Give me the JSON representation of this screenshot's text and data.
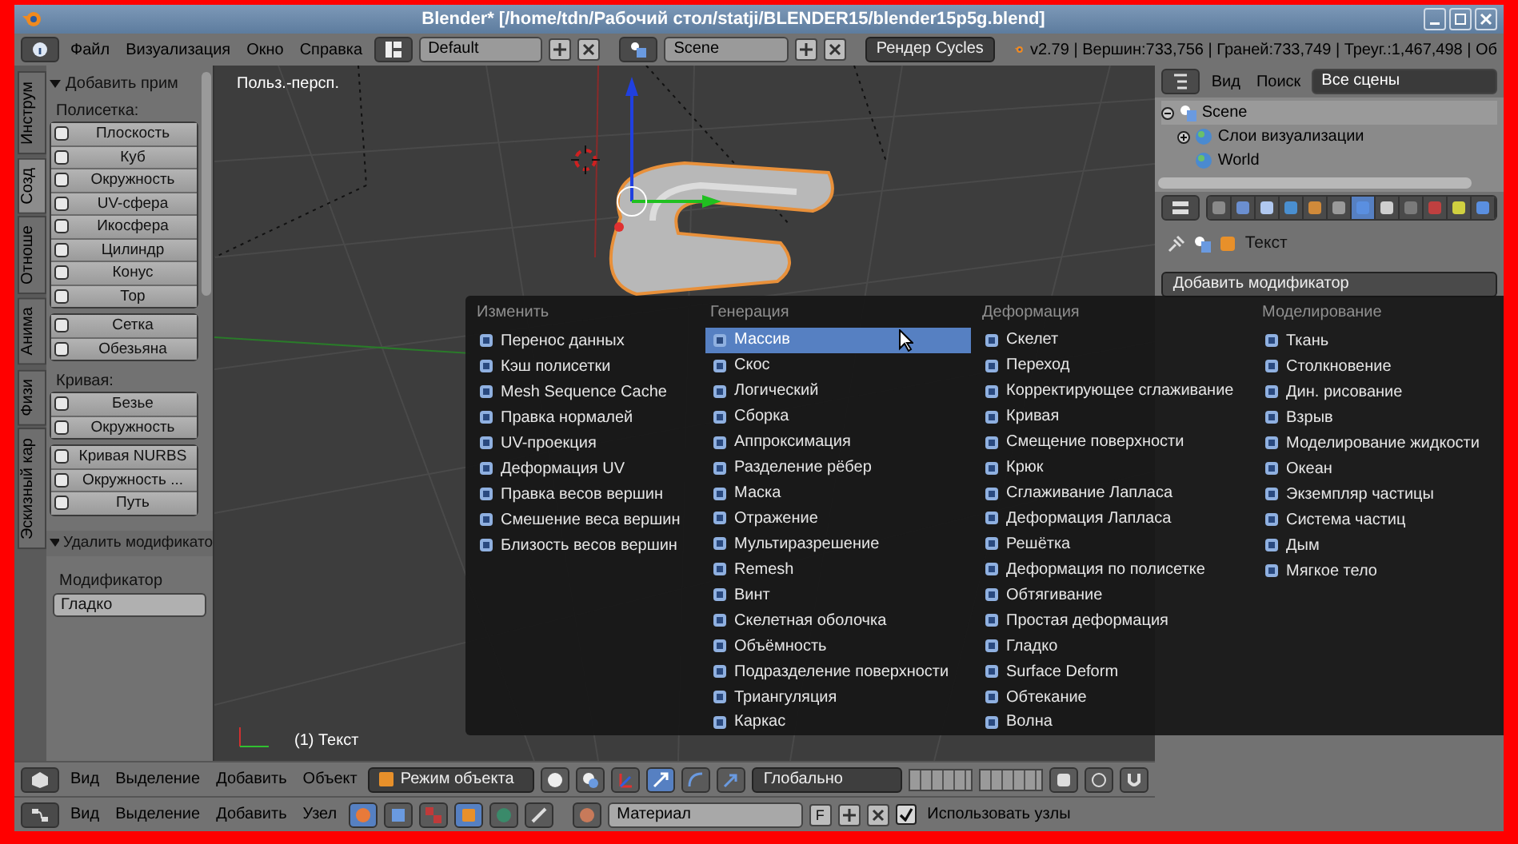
{
  "window": {
    "title": "Blender* [/home/tdn/Рабочий стол/statji/BLENDER15/blender15p5g.blend]"
  },
  "info_header": {
    "menus": [
      "Файл",
      "Визуализация",
      "Окно",
      "Справка"
    ],
    "layout": "Default",
    "scene": "Scene",
    "render_engine": "Рендер Cycles",
    "stats": "v2.79 | Вершин:733,756 | Граней:733,749 | Треуг.:1,467,498 | Об"
  },
  "tool_shelf": {
    "tabs": [
      {
        "label": "Инструм",
        "selected": false
      },
      {
        "label": "Созд",
        "selected": true
      },
      {
        "label": "Отноше",
        "selected": false
      },
      {
        "label": "Анима",
        "selected": false
      },
      {
        "label": "Физи",
        "selected": false
      },
      {
        "label": "Эскизный кар",
        "selected": false
      }
    ],
    "panel_title": "Добавить прим",
    "groups": [
      {
        "label": "Полисетка:",
        "blocks": [
          [
            "Плоскость",
            "Куб",
            "Окружность",
            "UV-сфера",
            "Икосфера",
            "Цилиндр",
            "Конус",
            "Тор"
          ],
          [
            "Сетка",
            "Обезьяна"
          ]
        ]
      },
      {
        "label": "Кривая:",
        "blocks": [
          [
            "Безье",
            "Окружность"
          ],
          [
            "Кривая NURBS",
            "Окружность ...",
            "Путь"
          ]
        ]
      }
    ],
    "remove_panel": {
      "title": "Удалить модификато",
      "label": "Модификатор",
      "value": "Гладко"
    }
  },
  "viewport": {
    "view_label": "Польз.-персп.",
    "object_label": "(1) Текст"
  },
  "add_modifier_menu": {
    "columns": [
      {
        "title": "Изменить",
        "items": [
          {
            "label": "Перенос данных",
            "selected": false
          },
          {
            "label": "Кэш полисетки",
            "selected": false
          },
          {
            "label": "Mesh Sequence Cache",
            "selected": false
          },
          {
            "label": "Правка нормалей",
            "selected": false
          },
          {
            "label": "UV-проекция",
            "selected": false
          },
          {
            "label": "Деформация UV",
            "selected": false
          },
          {
            "label": "Правка весов вершин",
            "selected": false
          },
          {
            "label": "Смешение веса вершин",
            "selected": false
          },
          {
            "label": "Близость весов вершин",
            "selected": false
          }
        ]
      },
      {
        "title": "Генерация",
        "items": [
          {
            "label": "Массив",
            "selected": true
          },
          {
            "label": "Скос",
            "selected": false
          },
          {
            "label": "Логический",
            "selected": false
          },
          {
            "label": "Сборка",
            "selected": false
          },
          {
            "label": "Аппроксимация",
            "selected": false
          },
          {
            "label": "Разделение рёбер",
            "selected": false
          },
          {
            "label": "Маска",
            "selected": false
          },
          {
            "label": "Отражение",
            "selected": false
          },
          {
            "label": "Мультиразрешение",
            "selected": false
          },
          {
            "label": "Remesh",
            "selected": false
          },
          {
            "label": "Винт",
            "selected": false
          },
          {
            "label": "Скелетная оболочка",
            "selected": false
          },
          {
            "label": "Объёмность",
            "selected": false
          },
          {
            "label": "Подразделение поверхности",
            "selected": false
          },
          {
            "label": "Триангуляция",
            "selected": false
          },
          {
            "label": "Каркас",
            "selected": false
          }
        ]
      },
      {
        "title": "Деформация",
        "items": [
          {
            "label": "Скелет",
            "selected": false
          },
          {
            "label": "Переход",
            "selected": false
          },
          {
            "label": "Корректирующее сглаживание",
            "selected": false
          },
          {
            "label": "Кривая",
            "selected": false
          },
          {
            "label": "Смещение поверхности",
            "selected": false
          },
          {
            "label": "Крюк",
            "selected": false
          },
          {
            "label": "Сглаживание Лапласа",
            "selected": false
          },
          {
            "label": "Деформация Лапласа",
            "selected": false
          },
          {
            "label": "Решётка",
            "selected": false
          },
          {
            "label": "Деформация по полисетке",
            "selected": false
          },
          {
            "label": "Обтягивание",
            "selected": false
          },
          {
            "label": "Простая деформация",
            "selected": false
          },
          {
            "label": "Гладко",
            "selected": false
          },
          {
            "label": "Surface Deform",
            "selected": false
          },
          {
            "label": "Обтекание",
            "selected": false
          },
          {
            "label": "Волна",
            "selected": false
          }
        ]
      },
      {
        "title": "Моделирование",
        "items": [
          {
            "label": "Ткань",
            "selected": false
          },
          {
            "label": "Столкновение",
            "selected": false
          },
          {
            "label": "Дин. рисование",
            "selected": false
          },
          {
            "label": "Взрыв",
            "selected": false
          },
          {
            "label": "Моделирование жидкости",
            "selected": false
          },
          {
            "label": "Океан",
            "selected": false
          },
          {
            "label": "Экземпляр частицы",
            "selected": false
          },
          {
            "label": "Система частиц",
            "selected": false
          },
          {
            "label": "Дым",
            "selected": false
          },
          {
            "label": "Мягкое тело",
            "selected": false
          }
        ]
      }
    ]
  },
  "outliner": {
    "menus": [
      "Вид",
      "Поиск"
    ],
    "filter": "Все сцены",
    "tree": [
      {
        "label": "Scene",
        "expanded": true,
        "children": [
          {
            "label": "Слои визуализации",
            "expanded": false
          },
          {
            "label": "World"
          }
        ]
      }
    ]
  },
  "properties": {
    "tabs": [
      {
        "selected": false
      },
      {
        "selected": false
      },
      {
        "selected": false
      },
      {
        "selected": false
      },
      {
        "selected": false
      },
      {
        "selected": false
      },
      {
        "selected": true
      },
      {
        "selected": false
      },
      {
        "selected": false
      },
      {
        "selected": false
      },
      {
        "selected": false
      },
      {
        "selected": false
      }
    ],
    "breadcrumb": "Текст",
    "add_modifier": "Добавить модификатор"
  },
  "view3d_header": {
    "menus": [
      "Вид",
      "Выделение",
      "Добавить",
      "Объект"
    ],
    "mode": "Режим объекта",
    "orientation": "Глобально"
  },
  "node_header": {
    "menus": [
      "Вид",
      "Выделение",
      "Добавить",
      "Узел"
    ],
    "material": "Материал",
    "fake_user": "F",
    "use_nodes": {
      "label": "Использовать узлы",
      "checked": true
    }
  }
}
